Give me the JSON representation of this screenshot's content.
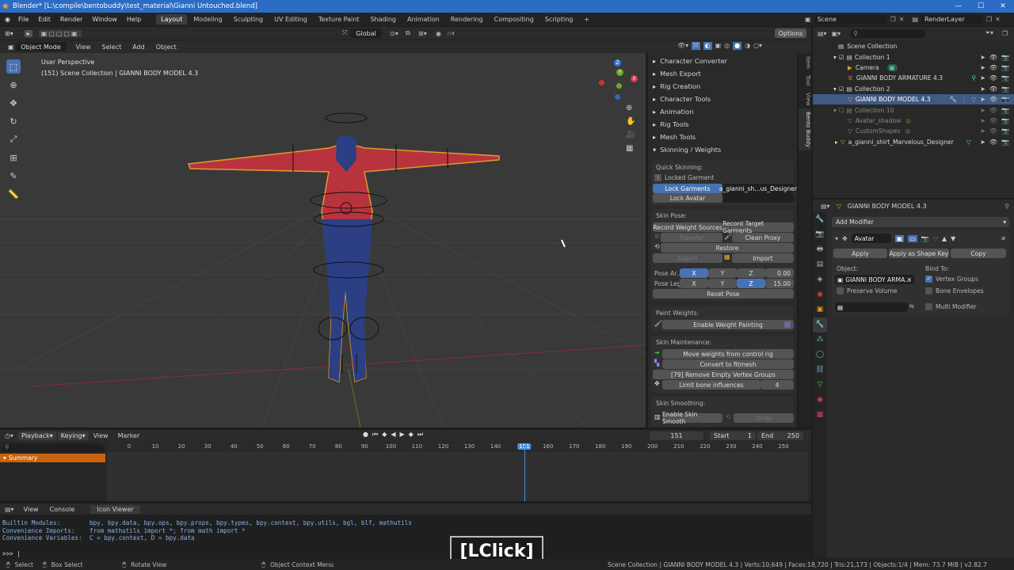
{
  "title_bar": {
    "title": "Blender* [L:\\compile\\bentobuddy\\test_material\\Gianni Untouched.blend]",
    "minimize": "—",
    "maximize": "☐",
    "close": "✕"
  },
  "menu": {
    "items": [
      "File",
      "Edit",
      "Render",
      "Window",
      "Help"
    ],
    "workspaces": [
      "Layout",
      "Modeling",
      "Sculpting",
      "UV Editing",
      "Texture Paint",
      "Shading",
      "Animation",
      "Rendering",
      "Compositing",
      "Scripting"
    ],
    "active_workspace": "Layout",
    "add_workspace": "+",
    "scene_name": "Scene",
    "view_layer": "RenderLayer"
  },
  "viewport": {
    "mode": "Object Mode",
    "menus": [
      "View",
      "Select",
      "Add",
      "Object"
    ],
    "orientation": "Global",
    "options": "Options",
    "perspective": "User Perspective",
    "collection_info": "(151) Scene Collection | GIANNI BODY MODEL 4.3",
    "gizmo": {
      "x": "X",
      "y": "Y",
      "z": "Z"
    }
  },
  "npanel": {
    "categories": [
      "Character Converter",
      "Mesh Export",
      "Rig Creation",
      "Character Tools",
      "Animation",
      "Rig Tools",
      "Mesh Tools",
      "Skinning / Weights"
    ],
    "quick_skinning": {
      "label": "Quick Skinning:",
      "locked_garment": "Locked Garment",
      "lock_garments": "Lock Garments",
      "garment_name": "a_gianni_sh...us_Designer",
      "lock_avatar": "Lock Avatar"
    },
    "skin_pose": {
      "label": "Skin Pose:",
      "record_weight_sources": "Record Weight Sources",
      "record_target_garments": "Record Target Garments",
      "transfer": "Transfer",
      "clean_proxy": "Clean Proxy",
      "restore": "Restore",
      "export": "Export",
      "import": "Import",
      "pose_arms_label": "Pose Ar..",
      "pose_legs_label": "Pose Legs",
      "x": "X",
      "y": "Y",
      "z": "Z",
      "arms_value": "0.00",
      "legs_value": "15.00",
      "reset_pose": "Reset Pose"
    },
    "paint_weights": {
      "label": "Paint Weights:",
      "enable": "Enable Weight Painting"
    },
    "skin_maintenance": {
      "label": "Skin Maintenance:",
      "move_weights": "Move weights from control rig",
      "convert_fitmesh": "Convert to fitmesh",
      "remove_empty": "[79] Remove Empty Vertex Groups",
      "limit_influences": "Limit bone influences",
      "limit_value": "4"
    },
    "skin_smoothing": {
      "label": "Skin Smoothing:",
      "enable": "Enable Skin Smooth",
      "undo": "Undo"
    },
    "tabs": [
      "Item",
      "Tool",
      "View",
      "Bento Buddy"
    ]
  },
  "outliner": {
    "root": "Scene Collection",
    "rows": [
      {
        "name": "Collection 1",
        "indent": 1
      },
      {
        "name": "Camera",
        "indent": 2
      },
      {
        "name": "GIANNI BODY ARMATURE 4.3",
        "indent": 2
      },
      {
        "name": "Collection 2",
        "indent": 1
      },
      {
        "name": "GIANNI BODY MODEL 4.3",
        "indent": 2
      },
      {
        "name": "Collection 10",
        "indent": 1
      },
      {
        "name": "Avatar_shadow",
        "indent": 2
      },
      {
        "name": "CustomShapes",
        "indent": 2
      },
      {
        "name": "a_gianni_shirt_Marvelous_Designer",
        "indent": 1
      }
    ]
  },
  "properties": {
    "object_name": "GIANNI BODY MODEL 4.3",
    "add_modifier": "Add Modifier",
    "modifier_name": "Avatar",
    "apply": "Apply",
    "apply_shape_key": "Apply as Shape Key",
    "copy": "Copy",
    "object_label": "Object:",
    "bind_to_label": "Bind To:",
    "object_value": "GIANNI BODY ARMA...",
    "vertex_groups": "Vertex Groups",
    "preserve_volume": "Preserve Volume",
    "bone_envelopes": "Bone Envelopes",
    "multi_modifier": "Multi Modifier"
  },
  "timeline": {
    "menus": [
      "Playback",
      "Keying",
      "View",
      "Marker"
    ],
    "current_frame": "151",
    "start_label": "Start",
    "start": "1",
    "end_label": "End",
    "end": "250",
    "ticks": [
      "0",
      "10",
      "20",
      "30",
      "40",
      "50",
      "60",
      "70",
      "80",
      "90",
      "100",
      "110",
      "120",
      "130",
      "140",
      "151",
      "160",
      "170",
      "180",
      "190",
      "200",
      "210",
      "220",
      "230",
      "240",
      "250"
    ],
    "summary": "Summary",
    "playhead_frame": 151
  },
  "console": {
    "menus": [
      "View",
      "Console"
    ],
    "tab": "Icon Viewer",
    "lines": [
      [
        "Builtin Modules:",
        "bpy, bpy.data, bpy.ops, bpy.props, bpy.types, bpy.context, bpy.utils, bgl, blf, mathutils"
      ],
      [
        "Convenience Imports:",
        "from mathutils import *; from math import *"
      ],
      [
        "Convenience Variables:",
        "C = bpy.context, D = bpy.data"
      ]
    ],
    "prompt": ">>> |"
  },
  "overlay": {
    "click_label": "[LClick]"
  },
  "status": {
    "select": "Select",
    "box_select": "Box Select",
    "rotate_view": "Rotate View",
    "context_menu": "Object Context Menu",
    "stats": "Scene Collection | GIANNI BODY MODEL 4.3 | Verts:10,649 | Faces:18,720 | Tris:21,173 | Objects:1/4 | Mem: 73.7 MiB | v2.82.7"
  },
  "colors": {
    "accent": "#4772b3",
    "selection": "#3f5a83",
    "title": "#2b6cc4",
    "orange": "#e39a2c"
  }
}
